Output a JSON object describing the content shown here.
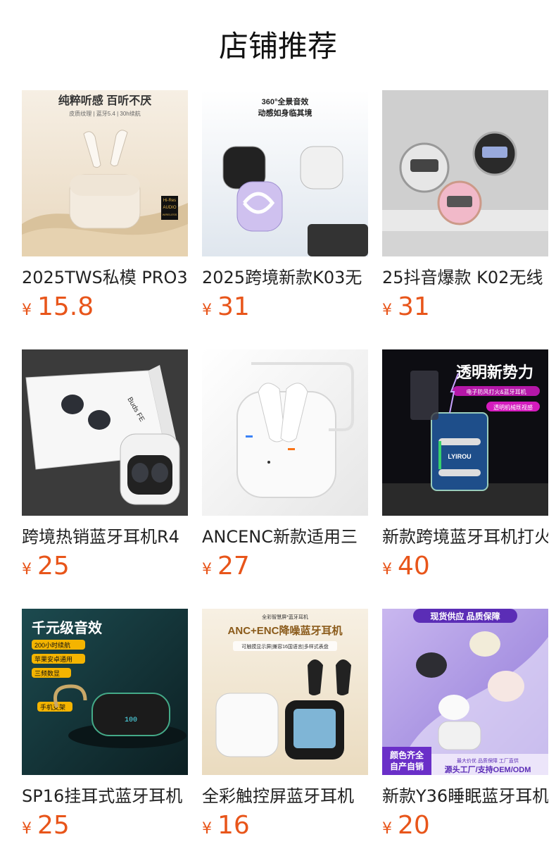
{
  "section": {
    "title": "店铺推荐",
    "currency_symbol": "¥"
  },
  "products": [
    {
      "name": "2025TWS私模 PRO3",
      "price": "15.8",
      "image": {
        "icon": "white-earbuds-case-photo",
        "headline": "纯粹听感 百听不厌",
        "sub": "皮质纹理 | 蓝牙5.4 | 30h续航",
        "badge_top": "Hi-Res",
        "badge_mid": "AUDIO",
        "badge_bottom": "WIRELESS"
      }
    },
    {
      "name": "2025跨境新款K03无",
      "price": "31",
      "image": {
        "icon": "clear-shell-open-ear-photo",
        "headline": "360°全景音效",
        "sub": "动感如身临其境"
      }
    },
    {
      "name": "25抖音爆款 K02无线",
      "price": "31",
      "image": {
        "icon": "clear-ring-earbuds-photo"
      }
    },
    {
      "name": "跨境热销蓝牙耳机R4",
      "price": "25",
      "image": {
        "icon": "buds-fe-box-photo",
        "box_label": "Buds FE"
      }
    },
    {
      "name": "ANCENC新款适用三",
      "price": "27",
      "image": {
        "icon": "white-pro-case-photo"
      }
    },
    {
      "name": "新款跨境蓝牙耳机打火",
      "price": "40",
      "image": {
        "icon": "lighter-earbuds-photo",
        "headline": "透明新势力",
        "tag1": "电子防风打火&蓝牙耳机",
        "tag2": "透明机械既视感",
        "brand": "LYIROU"
      }
    },
    {
      "name": "SP16挂耳式蓝牙耳机",
      "price": "25",
      "image": {
        "icon": "ear-hook-earbuds-photo",
        "headline": "千元级音效",
        "tags": [
          "200小时续航",
          "苹果安卓通用",
          "三频数显",
          "手机支架"
        ],
        "display": "100"
      }
    },
    {
      "name": "全彩触控屏蓝牙耳机",
      "price": "16",
      "image": {
        "icon": "touch-screen-case-photo",
        "kicker": "全彩智慧屏*蓝牙耳机",
        "headline": "ANC+ENC降噪蓝牙耳机",
        "sub": "可触摸显示屏|兼容16国语言|多样式表盘"
      }
    },
    {
      "name": "新款Y36睡眠蓝牙耳机",
      "price": "20",
      "image": {
        "icon": "sleep-earbuds-photo",
        "banner": "现货供应 品质保障",
        "corner1": "颜色齐全",
        "corner2": "自产自销",
        "footer1": "最大价优 品质保障 工厂直供",
        "footer2": "源头工厂/支持OEM/ODM"
      }
    }
  ],
  "colors": {
    "price": "#e8551a",
    "title": "#111111",
    "name": "#222222"
  }
}
